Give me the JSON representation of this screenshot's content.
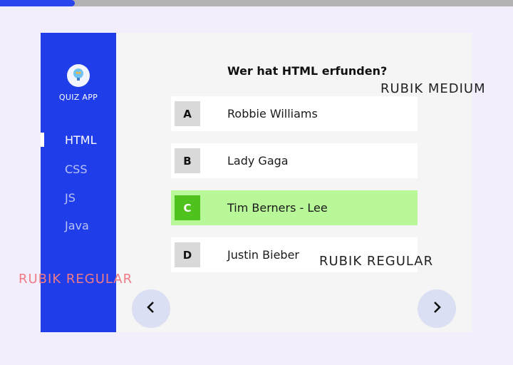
{
  "progress": {
    "fraction": 0.146
  },
  "sidebar": {
    "logo_icon": "brain-icon",
    "app_name": "QUIZ APP",
    "items": [
      {
        "label": "HTML",
        "active": true
      },
      {
        "label": "CSS",
        "active": false
      },
      {
        "label": "JS",
        "active": false
      },
      {
        "label": "Java",
        "active": false
      }
    ]
  },
  "quiz": {
    "question": "Wer hat HTML erfunden?",
    "answers": [
      {
        "letter": "A",
        "text": "Robbie Williams",
        "correct": false
      },
      {
        "letter": "B",
        "text": "Lady Gaga",
        "correct": false
      },
      {
        "letter": "C",
        "text": "Tim Berners - Lee",
        "correct": true
      },
      {
        "letter": "D",
        "text": "Justin Bieber",
        "correct": false
      }
    ]
  },
  "navigation": {
    "prev_icon": "chevron-left-icon",
    "next_icon": "chevron-right-icon"
  },
  "font_notes": {
    "medium": "RUBIK MEDIUM",
    "regular_main": "RUBIK REGULAR",
    "regular_sidebar": "RUBIK REGULAR"
  },
  "colors": {
    "accent": "#1f3ee9",
    "correct_bg": "#b8f898",
    "correct_badge": "#4fc21e",
    "note_sidebar": "#f07a86"
  }
}
